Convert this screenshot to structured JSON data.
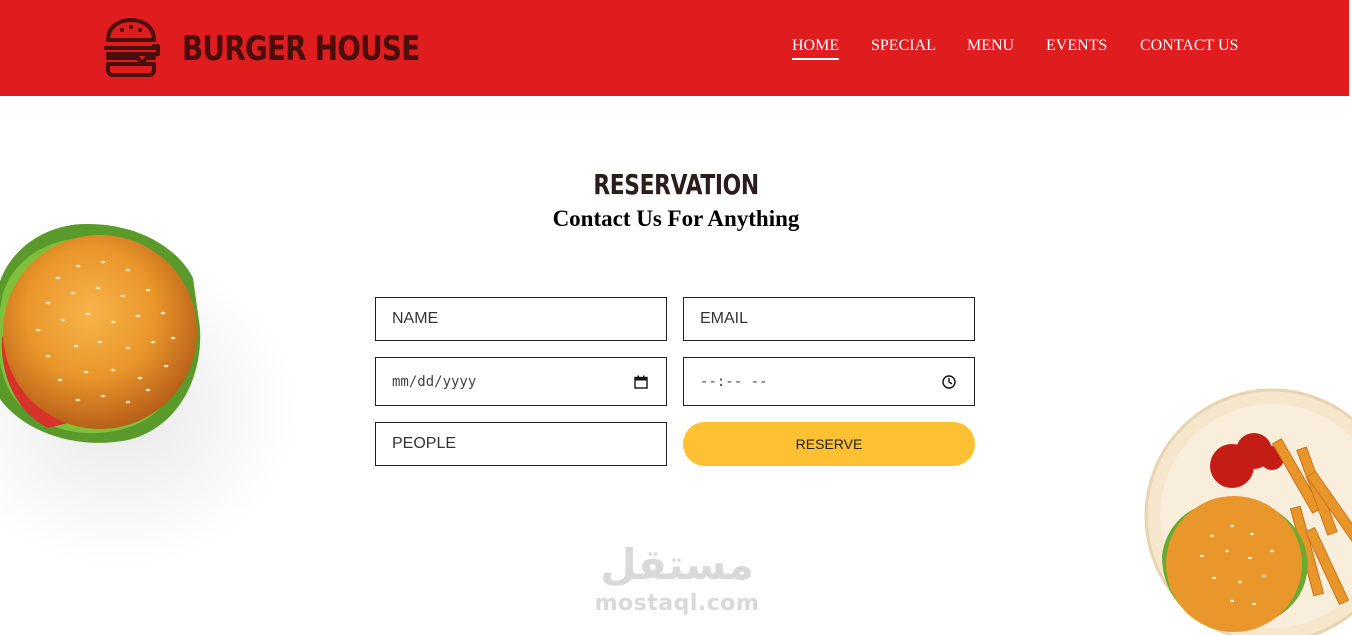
{
  "brand": {
    "name": "BURGER HOUSE",
    "logo_icon": "burger-icon",
    "color_primary": "#df1c1e",
    "color_logo": "#4a0f0c"
  },
  "nav": {
    "items": [
      {
        "label": "HOME",
        "active": true
      },
      {
        "label": "SPECIAL",
        "active": false
      },
      {
        "label": "MENU",
        "active": false
      },
      {
        "label": "EVENTS",
        "active": false
      },
      {
        "label": "CONTACT US",
        "active": false
      }
    ]
  },
  "reservation": {
    "title": "RESERVATION",
    "subtitle": "Contact Us For Anything",
    "fields": {
      "name_placeholder": "NAME",
      "email_placeholder": "EMAIL",
      "date_placeholder": "mm/dd/yyyy",
      "time_placeholder": "--:-- --",
      "people_placeholder": "PEOPLE"
    },
    "submit_label": "RESERVE",
    "submit_color": "#fec133"
  },
  "images": {
    "left": "burger-photo",
    "right": "burger-and-fries-plate-photo"
  },
  "watermark": {
    "arabic": "مستقل",
    "latin": "mostaql.com"
  }
}
